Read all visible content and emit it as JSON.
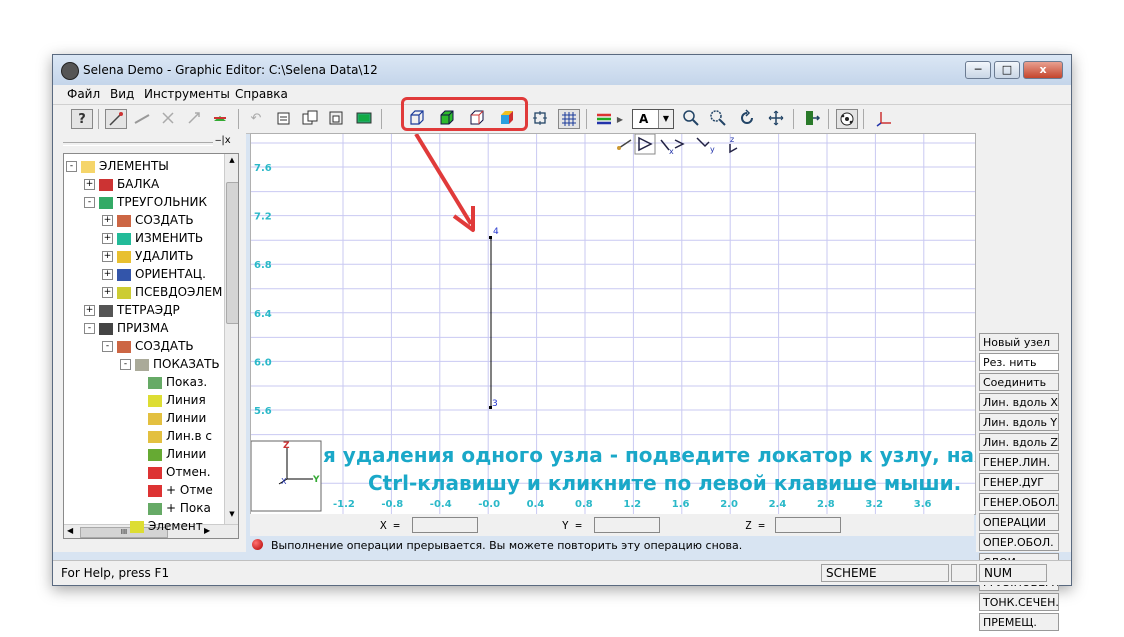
{
  "window": {
    "title": "Selena Demo - Graphic Editor:  C:\\Selena Data\\12",
    "min_label": "─",
    "max_label": "□",
    "close_label": "x"
  },
  "menu": [
    "Файл",
    "Вид",
    "Инструменты",
    "Справка"
  ],
  "toolbar": {
    "font_combo_value": "A",
    "highlight_color": "#e03a3a"
  },
  "left_panel": {
    "pin_label": "‒|x",
    "tree": [
      {
        "label": "ЭЛЕМЕНТЫ",
        "icon": "folder-icon",
        "exp": "-"
      },
      {
        "label": "БАЛКА",
        "icon": "beam-icon",
        "exp": "+"
      },
      {
        "label": "ТРЕУГОЛЬНИК",
        "icon": "triangle-icon",
        "exp": "-"
      },
      {
        "label": "СОЗДАТЬ",
        "icon": "create-icon",
        "exp": "+"
      },
      {
        "label": "ИЗМЕНИТЬ",
        "icon": "modify-icon",
        "exp": "+"
      },
      {
        "label": "УДАЛИТЬ",
        "icon": "delete-icon",
        "exp": "+"
      },
      {
        "label": "ОРИЕНТАЦ.",
        "icon": "orient-icon",
        "exp": "+"
      },
      {
        "label": "ПСЕВДОЭЛЕМ",
        "icon": "pseudo-icon",
        "exp": "+"
      },
      {
        "label": "ТЕТРАЭДР",
        "icon": "tetra-icon",
        "exp": "+"
      },
      {
        "label": "ПРИЗМА",
        "icon": "prism-icon",
        "exp": "-"
      },
      {
        "label": "СОЗДАТЬ",
        "icon": "create-icon",
        "exp": "-"
      },
      {
        "label": "ПОКАЗАТЬ",
        "icon": "show-icon",
        "exp": "-"
      },
      {
        "label": "Показ.",
        "icon": "show-small-icon",
        "exp": ""
      },
      {
        "label": "Линия",
        "icon": "check-icon",
        "exp": ""
      },
      {
        "label": "Линии",
        "icon": "lines-icon",
        "exp": ""
      },
      {
        "label": "Лин.в с",
        "icon": "lines-icon",
        "exp": ""
      },
      {
        "label": "Линии",
        "icon": "lines-down-icon",
        "exp": ""
      },
      {
        "label": "Отмен.",
        "icon": "cross-icon",
        "exp": ""
      },
      {
        "label": "+ Отме",
        "icon": "cross-icon",
        "exp": ""
      },
      {
        "label": "+ Пока",
        "icon": "show-small-icon",
        "exp": ""
      },
      {
        "label": "Элемент",
        "icon": "check-icon",
        "exp": ""
      }
    ],
    "hscroll_label": "III"
  },
  "canvas": {
    "y_ticks": [
      "7.6",
      "7.2",
      "6.8",
      "6.4",
      "6.0",
      "5.6"
    ],
    "x_ticks": [
      "-1.2",
      "-0.8",
      "-0.4",
      "-0.0",
      "0.4",
      "0.8",
      "1.2",
      "1.6",
      "2.0",
      "2.4",
      "2.8",
      "3.2",
      "3.6"
    ],
    "node_top": "4",
    "node_bottom": "3",
    "hint_line1": "я удаления одного узла - подведите локатор к узлу, нажмі",
    "hint_line2": "Ctrl-клавишу и кликните по левой клавише мыши.",
    "axis_z": "Z",
    "axis_y": "Y",
    "axis_x": "X",
    "view_x": "x",
    "view_y": "y",
    "view_z": "z",
    "grid_color": "#c9c9f2",
    "tick_color": "#2ab8c8",
    "hint_color": "#1aa8c8"
  },
  "right_panel": {
    "buttons": [
      "Новый узел",
      "Рез. нить",
      "Соединить",
      "Лин. вдоль X",
      "Лин. вдоль Y",
      "Лин. вдоль Z",
      "ГЕНЕР.ЛИН.",
      "ГЕНЕР.ДУГ",
      "ГЕНЕР.ОБОЛ.",
      "ОПЕРАЦИИ",
      "ОПЕР.ОБОЛ.",
      "СЛОИ",
      "ГРУЗ.ПОВЕРХ",
      "ТОНК.СЕЧЕН.",
      "ПРЕМЕЩ."
    ]
  },
  "coords": {
    "x_label": "X =",
    "y_label": "Y =",
    "z_label": "Z ="
  },
  "message": "Выполнение операции прерывается. Вы можете повторить эту операцию снова.",
  "status": {
    "help": "For Help, press F1",
    "scheme": "SCHEME",
    "num": "NUM"
  }
}
